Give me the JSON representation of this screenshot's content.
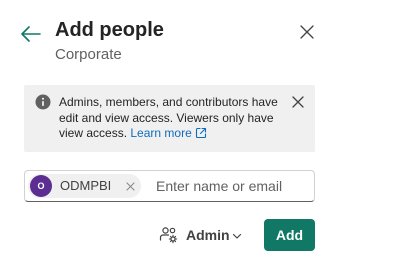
{
  "dialog": {
    "title": "Add people",
    "subtitle": "Corporate"
  },
  "banner": {
    "message": "Admins, members, and contributors have edit and view access. Viewers only have view access.",
    "link_label": "Learn more"
  },
  "people_input": {
    "chips": [
      {
        "initials": "O",
        "label": "ODMPBI",
        "avatar_color": "#5c2e91"
      }
    ],
    "value": "",
    "placeholder": "Enter name or email"
  },
  "role_select": {
    "selected": "Admin"
  },
  "actions": {
    "add_label": "Add"
  },
  "colors": {
    "primary": "#117865",
    "link": "#0f6cbd",
    "banner_bg": "#f0f0f0"
  },
  "icons": {
    "back": "arrow-left-icon",
    "close": "close-icon",
    "info": "info-icon",
    "open_link": "open-in-new-icon",
    "role": "people-settings-icon",
    "chevron": "chevron-down-icon"
  }
}
